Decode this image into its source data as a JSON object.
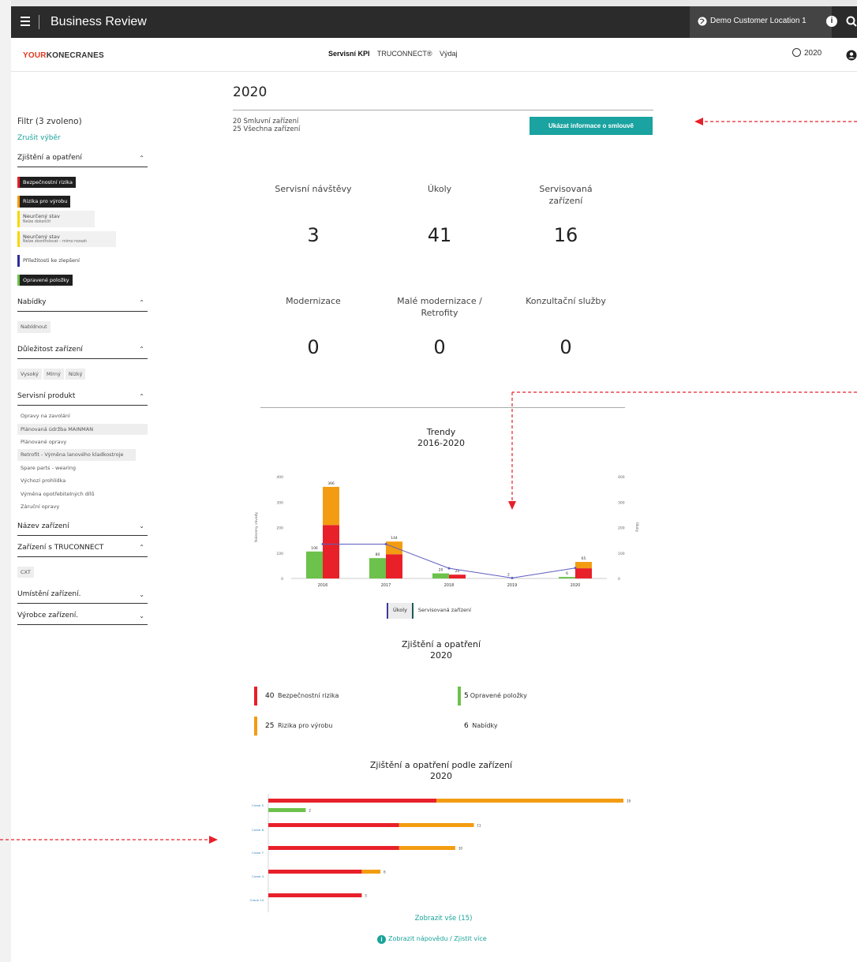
{
  "header": {
    "title": "Business Review",
    "location": "Demo Customer Location 1",
    "menu_icon": "hamburger-icon",
    "info_icon": "info-icon",
    "search_icon": "search-icon"
  },
  "navbar": {
    "logo_part1": "YOUR",
    "logo_part2": "KONECRANES",
    "tabs": [
      {
        "label": "Servisní KPI",
        "active": true
      },
      {
        "label": "TRUCONNECT®",
        "active": false
      },
      {
        "label": "Výdaj",
        "active": false
      }
    ],
    "year": "2020"
  },
  "sidebar": {
    "title": "Filtr (3 zvoleno)",
    "clear": "Zrušit výběr",
    "groups": {
      "findings": {
        "label": "Zjištění a opatření",
        "chips": [
          {
            "label": "Bezpečnostní rizika",
            "color": "#e8202a",
            "selected": true
          },
          {
            "label": "Rizika pro výrobu",
            "color": "#f39c12",
            "selected": true
          },
          {
            "label": "Neurčený stav",
            "sub": "Nelze dokončit",
            "color": "#f5d800",
            "selected": false
          },
          {
            "label": "Neurčený stav",
            "sub": "Nelze zkontrolovat – mimo rozsah",
            "color": "#f5d800",
            "selected": false
          },
          {
            "label": "Příležitosti ke zlepšení",
            "color": "#2d2d9a",
            "selected": false
          },
          {
            "label": "Opravené položky",
            "color": "#6cc24a",
            "selected": true
          }
        ]
      },
      "offers": {
        "label": "Nabídky",
        "chips": [
          "Nabídnout"
        ]
      },
      "importance": {
        "label": "Důležitost zařízení",
        "chips": [
          "Vysoký",
          "Mírný",
          "Nízký"
        ]
      },
      "product": {
        "label": "Servisní produkt",
        "chips": [
          "Opravy na zavolání",
          "Plánovaná údržba MAINMAN",
          "Plánované opravy",
          "Retrofit - Výměna lanového kladkostroje",
          "Spare parts - wearing",
          "Výchozí prohlídka",
          "Výměna opotřebitelných dílů",
          "Záruční opravy"
        ]
      },
      "name": {
        "label": "Název zařízení"
      },
      "truconnect": {
        "label": "Zařízení s TRUCONNECT",
        "chips": [
          "CXT"
        ]
      },
      "location": {
        "label": "Umístění zařízení."
      },
      "maker": {
        "label": "Výrobce zařízení."
      }
    }
  },
  "main": {
    "year": "2020",
    "contract_line1": "20 Smluvní zařízení",
    "contract_line2": "25 Všechna zařízení",
    "contract_button": "Ukázat informace o smlouvě",
    "kpis": [
      {
        "label": "Servisní návštěvy",
        "value": "3"
      },
      {
        "label": "Úkoly",
        "value": "41"
      },
      {
        "label": "Servisovaná zařízení",
        "value": "16"
      },
      {
        "label": "Modernizace",
        "value": "0"
      },
      {
        "label": "Malé modernizace / Retrofity",
        "value": "0"
      },
      {
        "label": "Konzultační služby",
        "value": "0"
      }
    ],
    "trend_title1": "Trendy",
    "trend_title2": "2016-2020",
    "legend": [
      "Úkoly",
      "Servisovaná zařízení"
    ],
    "findings_title1": "Zjištění a opatření",
    "findings_title2": "2020",
    "findings": [
      {
        "count": "40",
        "label": "Bezpečnostní rizika",
        "color": "#e8202a"
      },
      {
        "count": "25",
        "label": "Rizika pro výrobu",
        "color": "#f39c12"
      },
      {
        "count": "5",
        "label": "Opravené položky",
        "color": "#6cc24a"
      },
      {
        "count": "6",
        "label": "Nabídky",
        "color": ""
      }
    ],
    "equipment_title1": "Zjištění a opatření podle zařízení",
    "equipment_title2": "2020",
    "show_all": "Zobrazit vše (15)",
    "help": "Zobrazit nápovědu / Zjistit více"
  },
  "chart_data": [
    {
      "type": "bar",
      "title": "Trendy 2016-2020",
      "categories": [
        "2016",
        "2017",
        "2018",
        "2019",
        "2020"
      ],
      "ylim": [
        0,
        400
      ],
      "y2lim": [
        0,
        400
      ],
      "ylabel": "Nalezeny závady",
      "y2label": "Úkoly",
      "yticks": [
        "400",
        "300",
        "200",
        "100",
        "0"
      ],
      "y2ticks": [
        "400",
        "300",
        "200",
        "100",
        "0"
      ],
      "series": [
        {
          "name": "Opravené položky",
          "color": "#6cc24a",
          "values": [
            106,
            80,
            20,
            0,
            6
          ]
        },
        {
          "name": "Bezpečnostní rizika",
          "color": "#e8202a",
          "values": [
            210,
            95,
            15,
            0,
            40
          ]
        },
        {
          "name": "Rizika pro výrobu",
          "color": "#f39c12",
          "values": [
            150,
            50,
            0,
            0,
            25
          ]
        },
        {
          "name": "Úkoly",
          "type": "line",
          "color": "#5c5cc0",
          "values": [
            135,
            135,
            40,
            2,
            41
          ]
        }
      ],
      "data_labels": {
        "green": [
          "106",
          "80",
          "20",
          "",
          "6"
        ],
        "stack": [
          "366",
          "144",
          "20",
          "",
          "65"
        ],
        "line": [
          "",
          "",
          "",
          "2",
          ""
        ]
      }
    },
    {
      "type": "bar",
      "orientation": "horizontal",
      "title": "Zjištění a opatření podle zařízení 2020",
      "categories": [
        "Crane 5",
        "Crane 8",
        "Crane 7",
        "Crane 4",
        "Crane 14"
      ],
      "series": [
        {
          "name": "Bezpečnostní rizika",
          "color": "#e8202a",
          "values": [
            9,
            7,
            7,
            5,
            5
          ]
        },
        {
          "name": "Rizika pro výrobu",
          "color": "#f39c12",
          "values": [
            10,
            4,
            3,
            1,
            0
          ]
        },
        {
          "name": "Opravené položky",
          "color": "#6cc24a",
          "values": [
            2,
            0,
            0,
            0,
            0
          ]
        }
      ],
      "totals": [
        "19",
        "11",
        "10",
        "6",
        "5"
      ],
      "green_totals": [
        "2",
        "",
        "",
        "",
        ""
      ]
    }
  ]
}
